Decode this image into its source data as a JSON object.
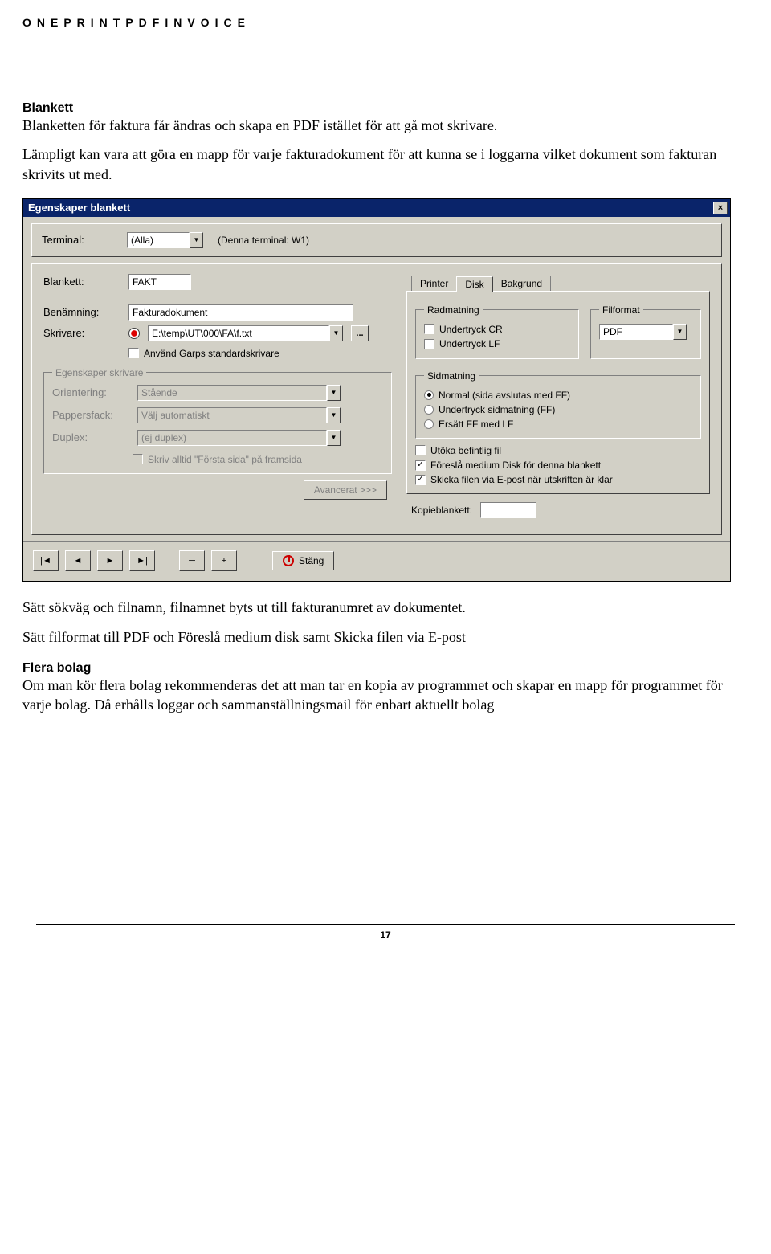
{
  "header_letters": "ONEPRINTPDFINVOICE",
  "section1": {
    "heading": "Blankett",
    "p1": "Blanketten för faktura får ändras och skapa en PDF istället för att gå mot skrivare.",
    "p2": "Lämpligt kan vara att göra en mapp för varje fakturadokument för att kunna se i loggarna vilket dokument som fakturan skrivits ut med."
  },
  "dialog": {
    "title": "Egenskaper blankett",
    "close": "×",
    "terminal_label": "Terminal:",
    "terminal_value": "(Alla)",
    "terminal_note": "(Denna terminal: W1)",
    "blankett_label": "Blankett:",
    "blankett_value": "FAKT",
    "benamning_label": "Benämning:",
    "benamning_value": "Fakturadokument",
    "skrivare_label": "Skrivare:",
    "skrivare_value": "E:\\temp\\UT\\000\\FA\\f.txt",
    "ellipsis": "...",
    "anvand_standard_label": "Använd Garps standardskrivare",
    "anvand_standard_checked": false,
    "egskriv": {
      "legend": "Egenskaper skrivare",
      "orientering_label": "Orientering:",
      "orientering_value": "Stående",
      "pappersfack_label": "Pappersfack:",
      "pappersfack_value": "Välj automatiskt",
      "duplex_label": "Duplex:",
      "duplex_value": "(ej duplex)",
      "skriv_alltid_label": "Skriv alltid \"Första sida\" på framsida"
    },
    "avancerat": "Avancerat >>>",
    "tabs": {
      "printer": "Printer",
      "disk": "Disk",
      "bakgrund": "Bakgrund"
    },
    "radmatning": {
      "legend": "Radmatning",
      "cr": "Undertryck CR",
      "lf": "Undertryck LF"
    },
    "filformat": {
      "legend": "Filformat",
      "value": "PDF"
    },
    "sidmatning": {
      "legend": "Sidmatning",
      "normal": "Normal (sida avslutas med FF)",
      "undertryck": "Undertryck sidmatning (FF)",
      "ersatt": "Ersätt FF med LF"
    },
    "utoka": "Utöka befintlig fil",
    "foresla": "Föreslå medium Disk för denna blankett",
    "skicka": "Skicka filen via E-post när utskriften är klar",
    "kopieblankett_label": "Kopieblankett:",
    "stang": "Stäng",
    "nav": {
      "first": "|◄",
      "prev": "◄",
      "play": "►",
      "next": "►|",
      "minus": "─",
      "plus": "+"
    }
  },
  "section2": {
    "p1": "Sätt sökväg och filnamn, filnamnet byts ut till fakturanumret av dokumentet.",
    "p2": "Sätt filformat till PDF och Föreslå medium disk samt Skicka filen via E-post",
    "heading": "Flera bolag",
    "p3": "Om man kör flera bolag rekommenderas det att man tar en kopia av programmet och skapar en mapp för programmet för varje bolag. Då erhålls loggar och sammanställningsmail för enbart aktuellt bolag"
  },
  "page_num": "17"
}
